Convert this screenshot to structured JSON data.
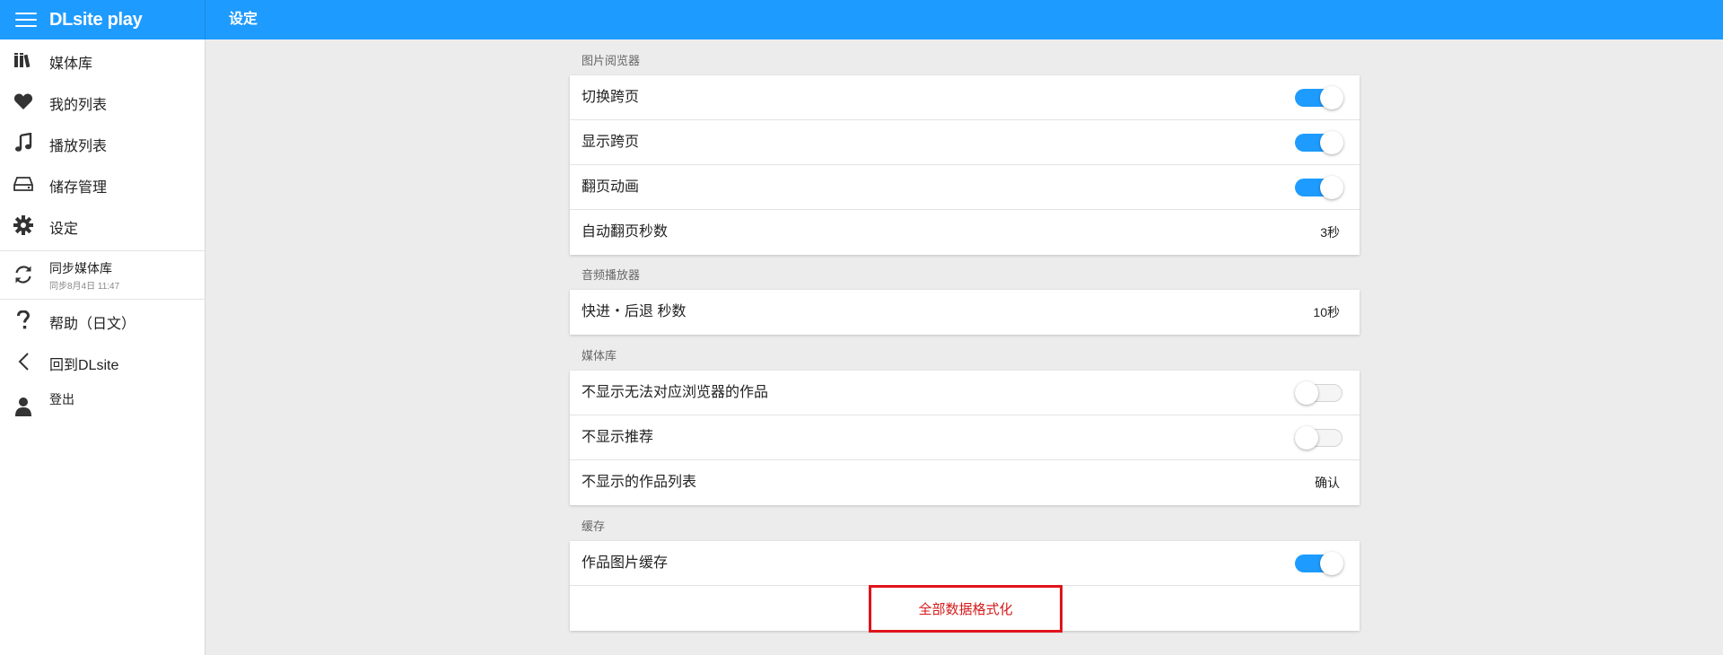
{
  "header": {
    "brand": "DLsite play",
    "page_title": "设定",
    "accent_color": "#1e9bff"
  },
  "sidebar": {
    "items": [
      {
        "label": "媒体库",
        "icon": "library-icon"
      },
      {
        "label": "我的列表",
        "icon": "heart-icon"
      },
      {
        "label": "播放列表",
        "icon": "music-note-icon"
      },
      {
        "label": "储存管理",
        "icon": "storage-drive-icon"
      },
      {
        "label": "设定",
        "icon": "gear-icon"
      }
    ],
    "sync": {
      "label": "同步媒体库",
      "sub": "同步8月4日 11:47",
      "icon": "sync-icon"
    },
    "bottom_items": [
      {
        "label": "帮助（日文）",
        "icon": "question-icon"
      },
      {
        "label": "回到DLsite",
        "icon": "chevron-left-icon"
      },
      {
        "label": "登出",
        "icon": "user-icon"
      }
    ]
  },
  "settings": {
    "image_viewer": {
      "title": "图片阅览器",
      "rows": [
        {
          "label": "切换跨页",
          "type": "toggle",
          "on": true
        },
        {
          "label": "显示跨页",
          "type": "toggle",
          "on": true
        },
        {
          "label": "翻页动画",
          "type": "toggle",
          "on": true
        },
        {
          "label": "自动翻页秒数",
          "type": "value",
          "value": "3秒"
        }
      ]
    },
    "audio_player": {
      "title": "音频播放器",
      "rows": [
        {
          "label": "快进・后退 秒数",
          "type": "value",
          "value": "10秒"
        }
      ]
    },
    "library": {
      "title": "媒体库",
      "rows": [
        {
          "label": "不显示无法对应浏览器的作品",
          "type": "toggle",
          "on": false
        },
        {
          "label": "不显示推荐",
          "type": "toggle",
          "on": false
        },
        {
          "label": "不显示的作品列表",
          "type": "value",
          "value": "确认"
        }
      ]
    },
    "cache": {
      "title": "缓存",
      "rows": [
        {
          "label": "作品图片缓存",
          "type": "toggle",
          "on": true
        }
      ],
      "format_button": "全部数据格式化",
      "format_color": "#d41a1a"
    }
  }
}
